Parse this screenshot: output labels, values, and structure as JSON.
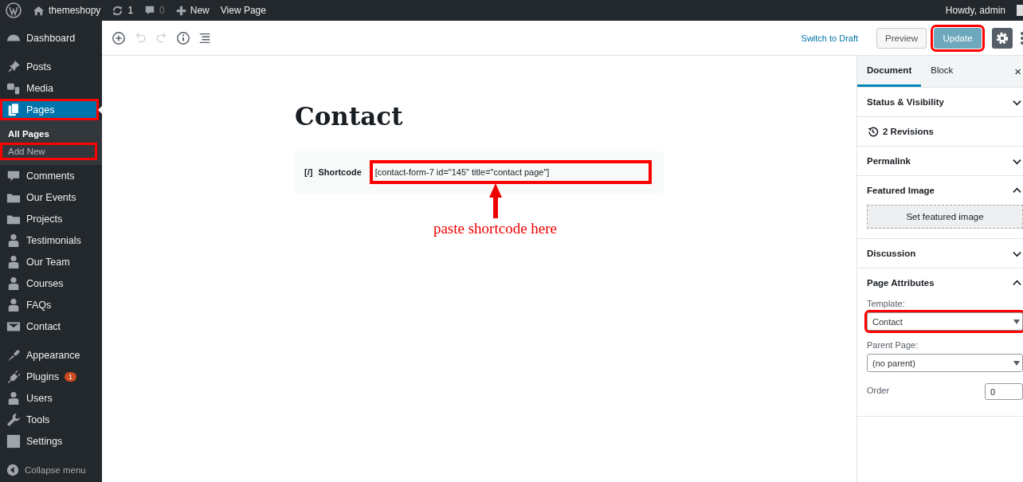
{
  "admin_bar": {
    "site": "themeshopy",
    "updates": "1",
    "comments": "0",
    "new": "New",
    "view": "View Page",
    "greeting": "Howdy, admin"
  },
  "sidebar": {
    "groups": [
      {
        "items": [
          {
            "label": "Dashboard",
            "selected": false,
            "highlighted": false
          }
        ]
      },
      {
        "items": [
          {
            "label": "Posts",
            "selected": false,
            "highlighted": false
          },
          {
            "label": "Media",
            "selected": false,
            "highlighted": false
          },
          {
            "label": "Pages",
            "selected": true,
            "highlighted": true,
            "submenu": [
              {
                "label": "All Pages",
                "selected": true,
                "highlighted": false
              },
              {
                "label": "Add New",
                "selected": false,
                "highlighted": true
              }
            ]
          },
          {
            "label": "Comments",
            "selected": false,
            "highlighted": false
          },
          {
            "label": "Our Events",
            "selected": false,
            "highlighted": false
          },
          {
            "label": "Projects",
            "selected": false,
            "highlighted": false
          },
          {
            "label": "Testimonials",
            "selected": false,
            "highlighted": false
          },
          {
            "label": "Our Team",
            "selected": false,
            "highlighted": false
          },
          {
            "label": "Courses",
            "selected": false,
            "highlighted": false
          },
          {
            "label": "FAQs",
            "selected": false,
            "highlighted": false
          },
          {
            "label": "Contact",
            "selected": false,
            "highlighted": false
          }
        ]
      },
      {
        "items": [
          {
            "label": "Appearance",
            "selected": false,
            "highlighted": false
          },
          {
            "label": "Plugins",
            "selected": false,
            "highlighted": false,
            "badge": "1"
          },
          {
            "label": "Users",
            "selected": false,
            "highlighted": false
          },
          {
            "label": "Tools",
            "selected": false,
            "highlighted": false
          },
          {
            "label": "Settings",
            "selected": false,
            "highlighted": false
          }
        ]
      }
    ],
    "collapse": "Collapse menu"
  },
  "toolbar": {
    "undo_disabled": true,
    "redo_disabled": true,
    "switch_to_draft": "Switch to Draft",
    "preview": "Preview",
    "update": {
      "label": "Update",
      "disabled": true,
      "highlighted": true
    },
    "settings_selected": true
  },
  "editor": {
    "title": "Contact",
    "block": {
      "icon_text": "[/]",
      "label": "Shortcode",
      "value": "[contact-form-7 id=\"145\" title=\"contact page\"]",
      "highlighted": true
    },
    "annotation": "paste shortcode here"
  },
  "settings_panel": {
    "tabs": [
      {
        "label": "Document",
        "selected": true
      },
      {
        "label": "Block",
        "selected": false
      }
    ],
    "close": "×",
    "panels": [
      {
        "kind": "panel",
        "title": "Status & Visibility",
        "expanded": false
      },
      {
        "kind": "revisions",
        "title": "2 Revisions"
      },
      {
        "kind": "panel",
        "title": "Permalink",
        "expanded": false
      },
      {
        "kind": "panel",
        "title": "Featured Image",
        "expanded": true,
        "button": "Set featured image"
      },
      {
        "kind": "panel",
        "title": "Discussion",
        "expanded": false
      },
      {
        "kind": "panel",
        "title": "Page Attributes",
        "expanded": true,
        "fields": [
          {
            "kind": "select",
            "label": "Template:",
            "value": "Contact",
            "highlighted": true
          },
          {
            "kind": "select",
            "label": "Parent Page:",
            "value": "(no parent)",
            "highlighted": false
          },
          {
            "kind": "number",
            "label": "Order",
            "value": "0",
            "highlighted": false
          }
        ]
      }
    ]
  }
}
